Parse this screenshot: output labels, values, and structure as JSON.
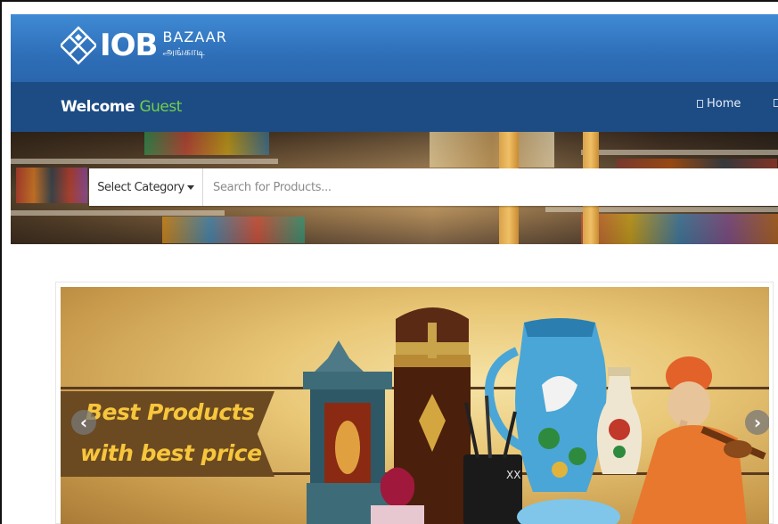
{
  "header": {
    "logo_text": "IOB",
    "logo_sub1": "BAZAAR",
    "logo_sub2": "அங்காடி",
    "brand_color": "#2e6fb8"
  },
  "nav": {
    "welcome_label": "Welcome",
    "user_name": "Guest",
    "home_label": "Home",
    "home_icon": "home-icon",
    "bar_color": "#1d4c84",
    "guest_color": "#6fd04a"
  },
  "search": {
    "category_label": "Select Category",
    "placeholder": "Search for Products..."
  },
  "carousel": {
    "line1": "Best Products",
    "line2": "with best price",
    "prev_icon": "chevron-left-icon",
    "next_icon": "chevron-right-icon",
    "prev_glyph": "‹",
    "next_glyph": "›",
    "text_color": "#f7c63c"
  }
}
